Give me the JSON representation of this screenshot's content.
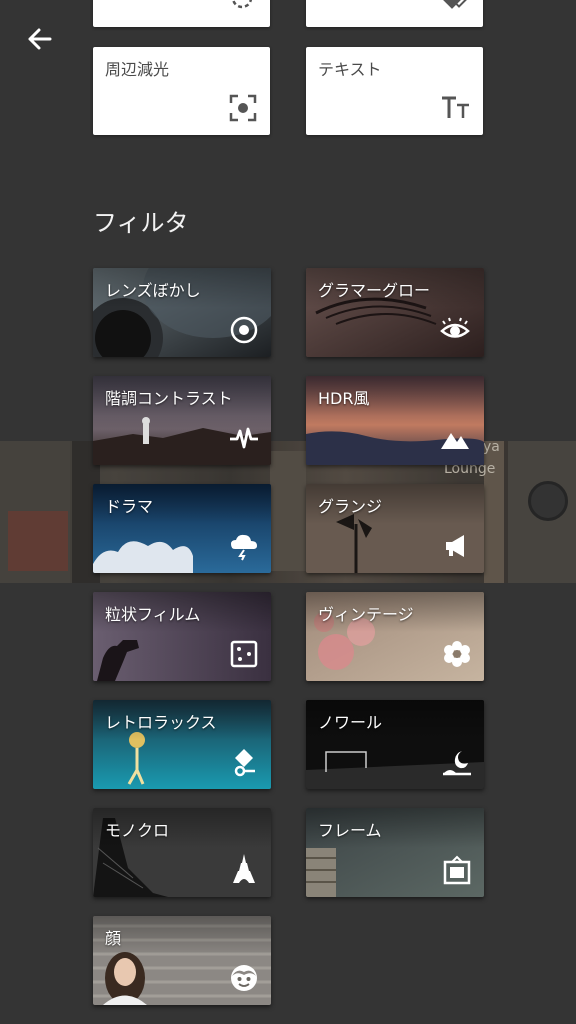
{
  "tools": [
    {
      "label": "周辺減光",
      "icon": "vignette-focus-icon"
    },
    {
      "label": "テキスト",
      "icon": "text-tt-icon"
    }
  ],
  "section_title": "フィルタ",
  "strip_texts": [
    "Lounge",
    "ya"
  ],
  "filters": [
    {
      "label": "レンズぼかし",
      "icon": "lens-blur-icon"
    },
    {
      "label": "グラマーグロー",
      "icon": "eye-icon"
    },
    {
      "label": "階調コントラスト",
      "icon": "pulse-icon"
    },
    {
      "label": "HDR風",
      "icon": "mountains-icon"
    },
    {
      "label": "ドラマ",
      "icon": "storm-cloud-icon"
    },
    {
      "label": "グランジ",
      "icon": "megaphone-icon"
    },
    {
      "label": "粒状フィルム",
      "icon": "dice-grain-icon"
    },
    {
      "label": "ヴィンテージ",
      "icon": "flower-icon"
    },
    {
      "label": "レトロラックス",
      "icon": "retrolux-icon"
    },
    {
      "label": "ノワール",
      "icon": "moon-horizon-icon"
    },
    {
      "label": "モノクロ",
      "icon": "eiffel-tower-icon"
    },
    {
      "label": "フレーム",
      "icon": "frame-icon"
    },
    {
      "label": "顔",
      "icon": "face-icon"
    }
  ],
  "colors": {
    "background": "#343434",
    "card": "#ffffff"
  }
}
